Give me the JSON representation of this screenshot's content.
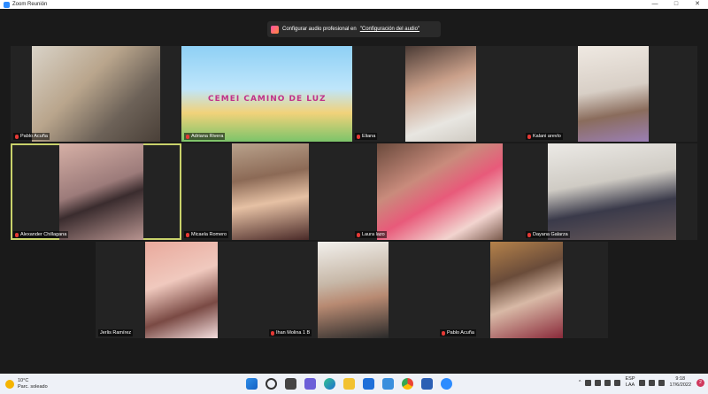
{
  "window": {
    "title": "Zoom Reunión",
    "minimize": "—",
    "maximize": "□",
    "close": "✕"
  },
  "banner": {
    "text": "Configurar audio profesional en",
    "link": "\"Configuración del audio\""
  },
  "participants": [
    {
      "name": "Pablo Acuña"
    },
    {
      "name": "Adriana Rivera",
      "overlay_text": "CEMEI CAMINO DE LUZ"
    },
    {
      "name": "Eliana"
    },
    {
      "name": "Kalani arevlo"
    },
    {
      "name": "Alexander Chillagana"
    },
    {
      "name": "Micaela Romero"
    },
    {
      "name": "Laura lazo"
    },
    {
      "name": "Dayana Galarza"
    },
    {
      "name": "Jerlis Ramírez"
    },
    {
      "name": "Ihan Molina 1 B"
    },
    {
      "name": "Pablo Acuña"
    }
  ],
  "taskbar": {
    "weather_temp": "10°C",
    "weather_desc": "Parc. soleado",
    "lang_1": "ESP",
    "lang_2": "LAA",
    "time": "9:18",
    "date": "17/6/2022",
    "notif_count": "2",
    "tray_chevron": "^"
  }
}
